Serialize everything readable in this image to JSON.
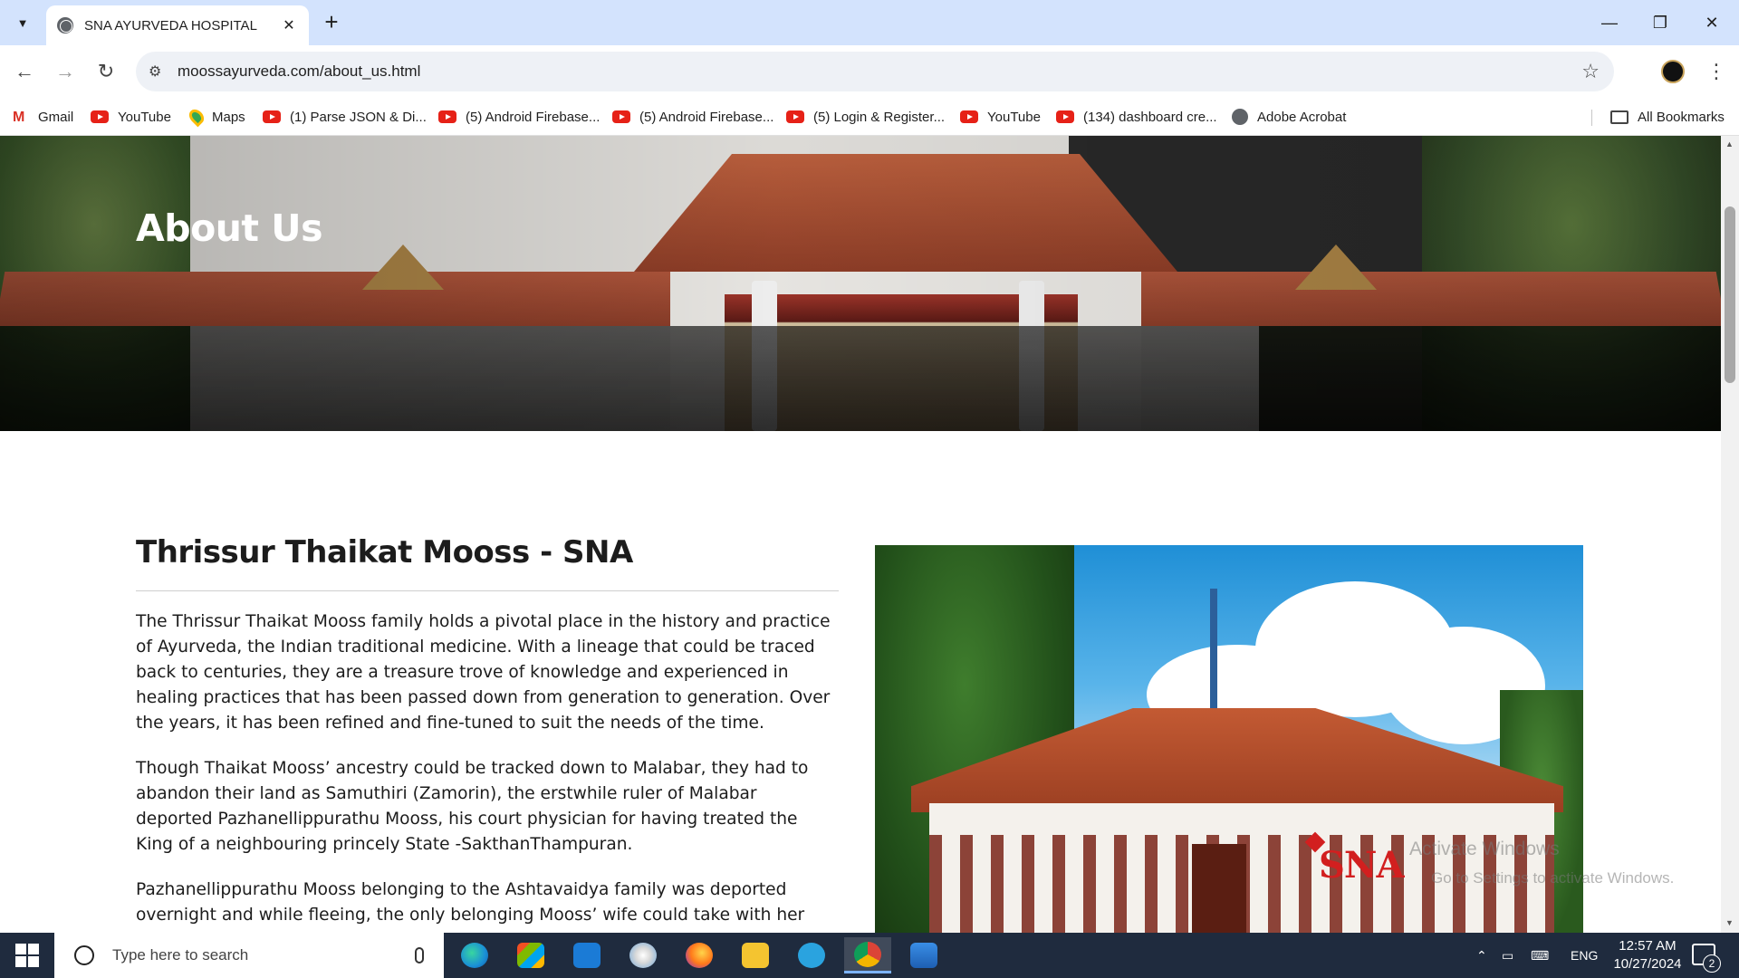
{
  "browser": {
    "tab_title": "SNA AYURVEDA HOSPITAL",
    "tab_close": "✕",
    "new_tab": "+",
    "url": "moossayurveda.com/about_us.html",
    "window_controls": {
      "minimize": "—",
      "restore": "❐",
      "close": "✕"
    },
    "nav": {
      "back": "←",
      "forward": "→",
      "reload": "↻"
    }
  },
  "bookmarks": [
    {
      "label": "Gmail",
      "icon": "gmail-icon"
    },
    {
      "label": "YouTube",
      "icon": "youtube-icon"
    },
    {
      "label": "Maps",
      "icon": "maps-icon"
    },
    {
      "label": "(1) Parse JSON & Di...",
      "icon": "youtube-icon"
    },
    {
      "label": "(5) Android Firebase...",
      "icon": "youtube-icon"
    },
    {
      "label": "(5) Android Firebase...",
      "icon": "youtube-icon"
    },
    {
      "label": "(5) Login & Register...",
      "icon": "youtube-icon"
    },
    {
      "label": "YouTube",
      "icon": "youtube-icon"
    },
    {
      "label": "(134) dashboard cre...",
      "icon": "youtube-icon"
    },
    {
      "label": "Adobe Acrobat",
      "icon": "globe-icon"
    }
  ],
  "all_bookmarks": "All Bookmarks",
  "page": {
    "hero_title": "About Us",
    "section_title": "Thrissur Thaikat Mooss - SNA",
    "paragraphs": [
      "The Thrissur Thaikat Mooss family holds a pivotal place in the history and practice of Ayurveda, the Indian traditional medicine. With a lineage that could be traced back to centuries, they are a treasure trove of knowledge and experienced in healing practices that has been passed down from generation to generation. Over the years, it has been refined and fine-tuned to suit the needs of the time.",
      "Though Thaikat Mooss’ ancestry could be tracked down to Malabar, they had to abandon their land as Samuthiri (Zamorin), the erstwhile ruler of Malabar deported Pazhanellippurathu Mooss, his court physician for having treated the King of a neighbouring princely State -SakthanThampuran.",
      "Pazhanellippurathu Mooss belonging to the Ashtavaidya family was deported overnight and while fleeing, the only belonging Mooss’ wife could take with her was"
    ],
    "photo_logo": "SNA"
  },
  "overlay": {
    "activate_title": "Activate Windows",
    "activate_sub": "Go to Settings to activate Windows."
  },
  "taskbar": {
    "search_placeholder": "Type here to search",
    "apps": [
      "edge-icon",
      "store-icon",
      "mail-icon",
      "paint-icon",
      "firefox-icon",
      "file-explorer-icon",
      "telegram-icon",
      "chrome-icon",
      "photos-icon"
    ],
    "language": "ENG",
    "time": "12:57 AM",
    "date": "10/27/2024",
    "notification_count": "2"
  },
  "colors": {
    "tab_strip": "#d3e3fd",
    "taskbar": "#1f2b3e",
    "youtube_red": "#e62117",
    "logo_red": "#d21f1f"
  }
}
